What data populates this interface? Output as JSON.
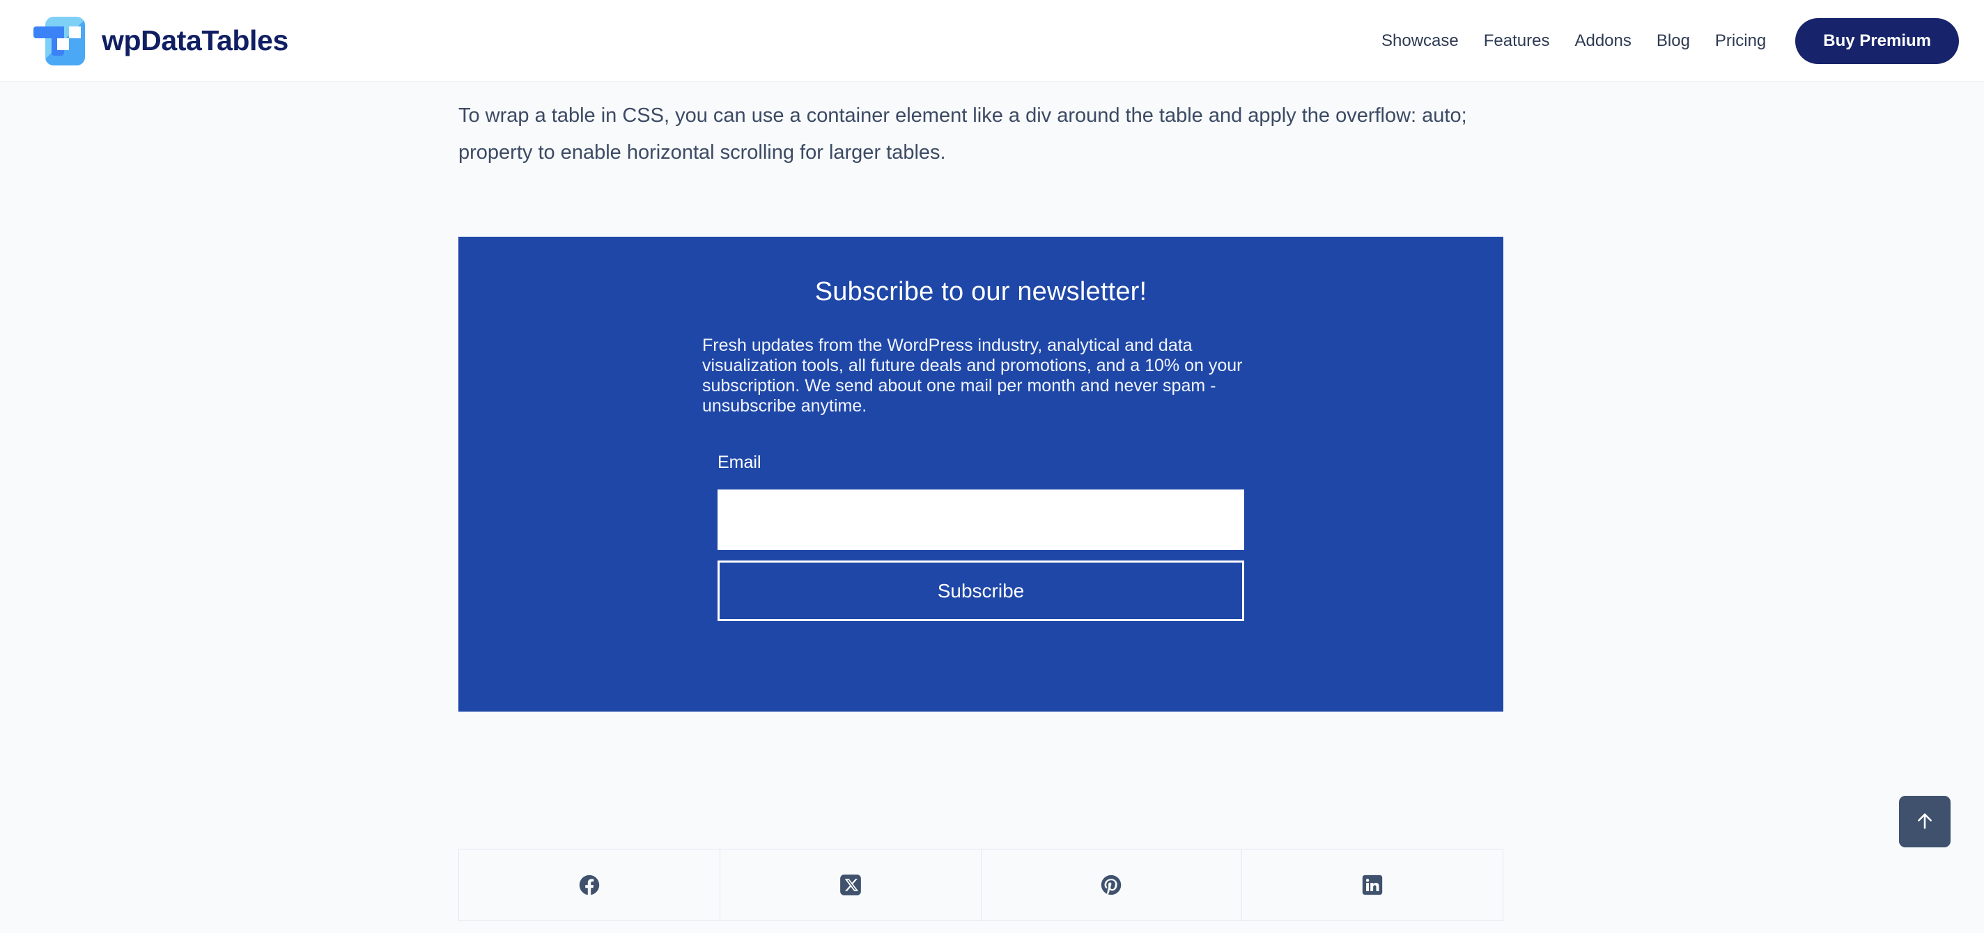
{
  "header": {
    "brand_name": "wpDataTables",
    "logo_icon": "wpdatatables-logo-icon",
    "nav_items": [
      {
        "label": "Showcase"
      },
      {
        "label": "Features"
      },
      {
        "label": "Addons"
      },
      {
        "label": "Blog"
      },
      {
        "label": "Pricing"
      }
    ],
    "cta_label": "Buy Premium",
    "colors": {
      "brand_navy": "#101f63",
      "cta_bg": "#17246b",
      "nav_text": "#2d3a52"
    }
  },
  "article": {
    "paragraph": "To wrap a table in CSS, you can use a container element like a div around the table and apply the overflow: auto; property to enable horizontal scrolling for larger tables."
  },
  "newsletter": {
    "title": "Subscribe to our newsletter!",
    "description": "Fresh updates from the WordPress industry, analytical and data visualization tools, all future deals and promotions, and a 10% on your subscription. We send about one mail per month and never spam - unsubscribe anytime.",
    "email_label": "Email",
    "email_value": "",
    "email_placeholder": "",
    "subscribe_label": "Subscribe",
    "background_color": "#1f47a8"
  },
  "social": {
    "items": [
      {
        "name": "facebook-icon",
        "label": "Facebook"
      },
      {
        "name": "x-twitter-icon",
        "label": "X"
      },
      {
        "name": "pinterest-icon",
        "label": "Pinterest"
      },
      {
        "name": "linkedin-icon",
        "label": "LinkedIn"
      }
    ],
    "icon_color": "#3f516c"
  },
  "scroll_top": {
    "icon": "arrow-up-icon",
    "background_color": "#3f516c"
  },
  "page": {
    "background_color": "#f8fafc"
  }
}
